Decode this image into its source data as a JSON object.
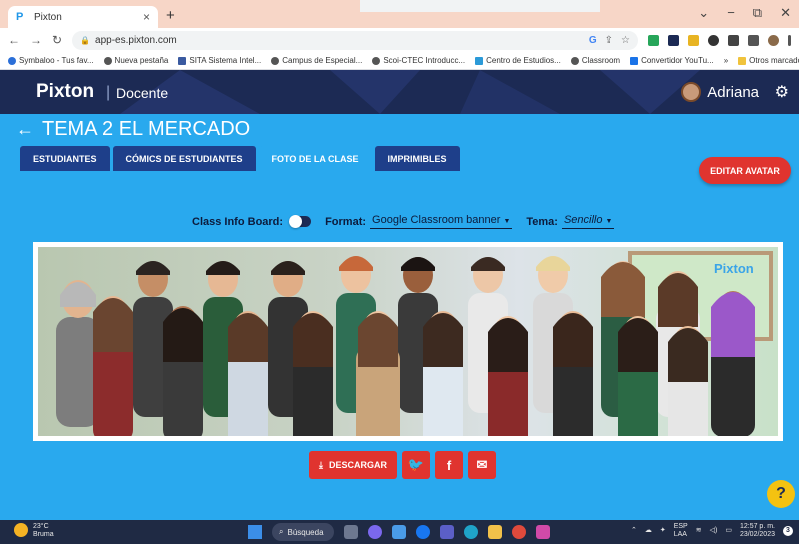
{
  "browser": {
    "tab_title": "Pixton",
    "url": "app-es.pixton.com",
    "bookmarks": [
      "Symbaloo - Tus fav...",
      "Nueva pestaña",
      "SITA Sistema Intel...",
      "Campus de Especial...",
      "Scoi-CTEC Introducc...",
      "Centro de Estudios...",
      "Classroom",
      "Convertidor YouTu..."
    ],
    "bookmarks_more": "»",
    "other_bookmarks": "Otros marcadores"
  },
  "header": {
    "logo": "Pixton",
    "separator": "|",
    "role": "Docente",
    "user_name": "Adriana"
  },
  "page": {
    "title": "TEMA 2 EL MERCADO",
    "tabs": [
      {
        "label": "ESTUDIANTES",
        "active": false
      },
      {
        "label": "CÓMICS DE ESTUDIANTES",
        "active": false
      },
      {
        "label": "FOTO DE LA CLASE",
        "active": true
      },
      {
        "label": "IMPRIMIBLES",
        "active": false
      }
    ],
    "edit_avatar": "EDITAR AVATAR"
  },
  "options": {
    "class_info_board_label": "Class Info Board:",
    "class_info_board_on": false,
    "format_label": "Format:",
    "format_value": "Google Classroom banner",
    "theme_label": "Tema:",
    "theme_value": "Sencillo"
  },
  "photo": {
    "watermark": "Pixton"
  },
  "actions": {
    "download": "DESCARGAR"
  },
  "help": "?",
  "taskbar": {
    "temp": "23°C",
    "weather": "Bruma",
    "search": "Búsqueda",
    "lang": "ESP",
    "region": "LAA",
    "time": "12:57 p. m.",
    "date": "23/02/2023",
    "notif_count": "3"
  },
  "colors": {
    "page_bg": "#29a9ee",
    "header_bg": "#1c2a54",
    "tab_bg": "#1e3f8a",
    "accent_red": "#e0342f",
    "help_yellow": "#f4c211"
  }
}
